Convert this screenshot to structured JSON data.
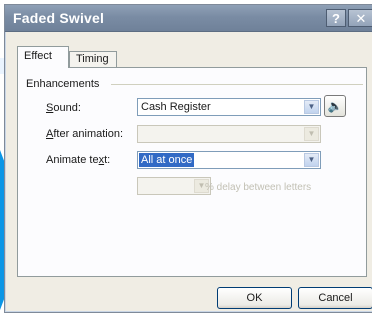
{
  "dialog": {
    "title": "Faded Swivel",
    "help_glyph": "?",
    "close_glyph": "✕"
  },
  "tabs": [
    {
      "label": "Effect"
    },
    {
      "label": "Timing"
    }
  ],
  "enhancements": {
    "group_label": "Enhancements",
    "sound": {
      "label_pre": "",
      "label_key": "S",
      "label_post": "ound:",
      "value": "Cash Register"
    },
    "after_animation": {
      "label_pre": "",
      "label_key": "A",
      "label_post": "fter animation:",
      "value": ""
    },
    "animate_text": {
      "label_pre": "Animate te",
      "label_key": "x",
      "label_post": "t:",
      "value": "All at once"
    },
    "delay_value": "",
    "delay_label": "% delay between letters"
  },
  "buttons": {
    "ok": "OK",
    "cancel": "Cancel"
  },
  "icons": {
    "speaker": "speaker-icon",
    "dropdown": "chevron-down-icon"
  }
}
